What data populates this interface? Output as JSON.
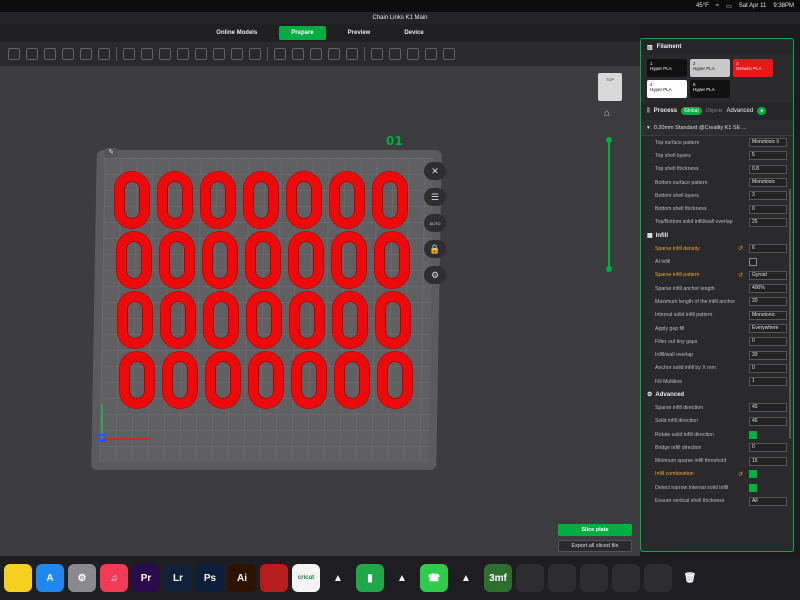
{
  "menubar": {
    "weather": "45°F",
    "date": "Sat Apr 11",
    "time": "9:38PM"
  },
  "window_title": "Chain Links K1 Main",
  "nav": {
    "tabs": [
      "Online Models",
      "Prepare",
      "Preview",
      "Device"
    ],
    "active": "Prepare"
  },
  "viewport": {
    "plate_label": "01",
    "viewcube_label": "TOP",
    "plate_edit_icon": "pencil-icon",
    "auto_label": "AUTO"
  },
  "plate": {
    "rows": 4,
    "cols": 7,
    "model_color": "#ee0a0a"
  },
  "buttons": {
    "slice": "Slice plate",
    "export": "Export all sliced file"
  },
  "panel": {
    "filament_title": "Filament",
    "filaments": [
      {
        "num": "1",
        "name": "Hyper PLA",
        "bg": "#111111",
        "fg": "#ffffff"
      },
      {
        "num": "2",
        "name": "Hyper PLA",
        "bg": "#c8c8c8",
        "fg": "#111111"
      },
      {
        "num": "3",
        "name": "Generic PLA",
        "bg": "#e81818",
        "fg": "#ffffff"
      },
      {
        "num": "4",
        "name": "Hyper PLA",
        "bg": "#ffffff",
        "fg": "#111111"
      },
      {
        "num": "5",
        "name": "Hyper PLA",
        "bg": "#111111",
        "fg": "#ffffff"
      }
    ],
    "process_title": "Process",
    "process_global": "Global",
    "process_objects": "Objects",
    "process_advanced": "Advanced",
    "preset": "0.20mm Standard @Creality K1 SE ...",
    "rows_top": [
      {
        "label": "Top surface pattern",
        "value": "Monotonic li",
        "icon": true
      },
      {
        "label": "Top shell layers",
        "value": "5"
      },
      {
        "label": "Top shell thickness",
        "value": "0.8"
      },
      {
        "label": "Bottom surface pattern",
        "value": "Monotonic",
        "icon": true
      },
      {
        "label": "Bottom shell layers",
        "value": "3"
      },
      {
        "label": "Bottom shell thickness",
        "value": "0"
      },
      {
        "label": "Top/Bottom solid infill/wall overlap",
        "value": "25"
      }
    ],
    "infill_group": "Infill",
    "rows_infill": [
      {
        "label": "Sparse infill density",
        "value": "6",
        "hl": true
      },
      {
        "label": "AI infill",
        "check": false
      },
      {
        "label": "Sparse infill pattern",
        "value": "Gyroid",
        "hl": true,
        "icon": true
      },
      {
        "label": "Sparse infill anchor length",
        "value": "400%"
      },
      {
        "label": "Maximum length of the infill anchor",
        "value": "20"
      },
      {
        "label": "Internal solid infill pattern",
        "value": "Monotonic",
        "icon": true
      },
      {
        "label": "Apply gap fill",
        "value": "Everywhere"
      },
      {
        "label": "Filter out tiny gaps",
        "value": "0"
      },
      {
        "label": "Infill/wall overlap",
        "value": "30"
      },
      {
        "label": "Anchor solid infill by X mm",
        "value": "0"
      },
      {
        "label": "Fill Multiline",
        "value": "1"
      }
    ],
    "advanced_group": "Advanced",
    "rows_adv": [
      {
        "label": "Sparse infill direction",
        "value": "45"
      },
      {
        "label": "Solid infill direction",
        "value": "45"
      },
      {
        "label": "Rotate solid infill direction",
        "check": true
      },
      {
        "label": "Bridge infill direction",
        "value": "0"
      },
      {
        "label": "Minimum sparse infill threshold",
        "value": "15"
      },
      {
        "label": "Infill combination",
        "check": true,
        "hl": true
      },
      {
        "label": "Detect narrow internal solid infill",
        "check": true
      },
      {
        "label": "Ensure vertical shell thickness",
        "value": "All"
      }
    ]
  },
  "dock": [
    {
      "name": "notes-app",
      "label": "",
      "bg": "#f5d020"
    },
    {
      "name": "app-store",
      "label": "A",
      "bg": "#1e88f0"
    },
    {
      "name": "system-settings",
      "label": "⚙",
      "bg": "#8a8a8e"
    },
    {
      "name": "music-app",
      "label": "♫",
      "bg": "#f23b55"
    },
    {
      "name": "premiere",
      "label": "Pr",
      "bg": "#2a0a4a"
    },
    {
      "name": "lightroom",
      "label": "Lr",
      "bg": "#0f2038"
    },
    {
      "name": "photoshop",
      "label": "Ps",
      "bg": "#0b1f3a"
    },
    {
      "name": "illustrator",
      "label": "Ai",
      "bg": "#2e1200"
    },
    {
      "name": "dragon-app",
      "label": "",
      "bg": "#b81d1d"
    },
    {
      "name": "cricut",
      "label": "cricut",
      "bg": "#f4f4f4"
    },
    {
      "name": "slicer-app",
      "label": "▲",
      "bg": "#1e1e22"
    },
    {
      "name": "numbers-app",
      "label": "▮",
      "bg": "#1ea84a"
    },
    {
      "name": "slicer-app-2",
      "label": "▲",
      "bg": "#1e1e22"
    },
    {
      "name": "facetime",
      "label": "☎",
      "bg": "#2ecc4a"
    },
    {
      "name": "slicer-app-3",
      "label": "▲",
      "bg": "#1e1e22"
    },
    {
      "name": "3mf-file",
      "label": "3mf",
      "bg": "#2e6e2e"
    },
    {
      "name": "window-thumb-1",
      "label": "",
      "bg": "#2d2d30"
    },
    {
      "name": "window-thumb-2",
      "label": "",
      "bg": "#2d2d30"
    },
    {
      "name": "window-thumb-3",
      "label": "",
      "bg": "#2d2d30"
    },
    {
      "name": "window-thumb-4",
      "label": "",
      "bg": "#2d2d30"
    },
    {
      "name": "window-thumb-5",
      "label": "",
      "bg": "#2d2d30"
    },
    {
      "name": "trash",
      "label": "🗑",
      "bg": "#1e1e22"
    }
  ]
}
